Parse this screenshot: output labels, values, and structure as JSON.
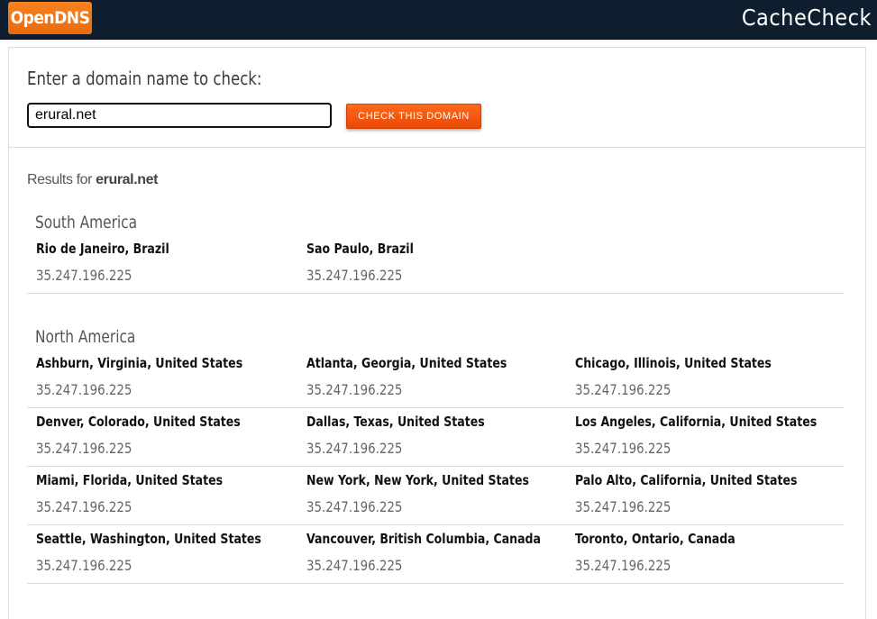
{
  "header": {
    "logo": "OpenDNS",
    "title": "CacheCheck",
    "bg_color": "#0e1e2e",
    "accent": "#f47b20"
  },
  "form": {
    "prompt": "Enter a domain name to check:",
    "domain_value": "erural.net",
    "button_label": "CHECK THIS DOMAIN"
  },
  "results": {
    "prefix": "Results for",
    "domain": "erural.net"
  },
  "regions": [
    {
      "name": "South America",
      "rows": [
        [
          {
            "city": "Rio de Janeiro, Brazil",
            "ip": "35.247.196.225"
          },
          {
            "city": "Sao Paulo, Brazil",
            "ip": "35.247.196.225"
          }
        ]
      ]
    },
    {
      "name": "North America",
      "rows": [
        [
          {
            "city": "Ashburn, Virginia, United States",
            "ip": "35.247.196.225"
          },
          {
            "city": "Atlanta, Georgia, United States",
            "ip": "35.247.196.225"
          },
          {
            "city": "Chicago, Illinois, United States",
            "ip": "35.247.196.225"
          }
        ],
        [
          {
            "city": "Denver, Colorado, United States",
            "ip": "35.247.196.225"
          },
          {
            "city": "Dallas, Texas, United States",
            "ip": "35.247.196.225"
          },
          {
            "city": "Los Angeles, California, United States",
            "ip": "35.247.196.225"
          }
        ],
        [
          {
            "city": "Miami, Florida, United States",
            "ip": "35.247.196.225"
          },
          {
            "city": "New York, New York, United States",
            "ip": "35.247.196.225"
          },
          {
            "city": "Palo Alto, California, United States",
            "ip": "35.247.196.225"
          }
        ],
        [
          {
            "city": "Seattle, Washington, United States",
            "ip": "35.247.196.225"
          },
          {
            "city": "Vancouver, British Columbia, Canada",
            "ip": "35.247.196.225"
          },
          {
            "city": "Toronto, Ontario, Canada",
            "ip": "35.247.196.225"
          }
        ]
      ]
    }
  ]
}
